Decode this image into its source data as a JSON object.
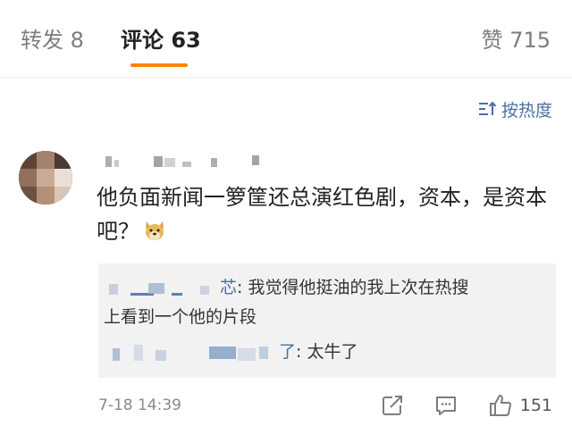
{
  "tabs": {
    "repost": "转发 8",
    "comments": "评论 63",
    "likes": "赞 715"
  },
  "sort": {
    "icon": "sort-icon",
    "label": "按热度"
  },
  "comment": {
    "text": "他负面新闻一箩筐还总演红色剧，资本，是资本吧？",
    "emoji_icon": "doge-emoji",
    "timestamp": "7-18 14:39",
    "like_count": "151"
  },
  "replies": [
    {
      "name_suffix": "芯",
      "text": ": 我觉得他挺油的我上次在热搜",
      "text_cont": "上看到一个他的片段"
    },
    {
      "name_suffix": "了",
      "text": ": 太牛了"
    }
  ],
  "colors": {
    "accent": "#ff8200",
    "link": "#4a6fa5",
    "reply_bg": "#f2f2f2",
    "muted": "#7d7d7d"
  }
}
